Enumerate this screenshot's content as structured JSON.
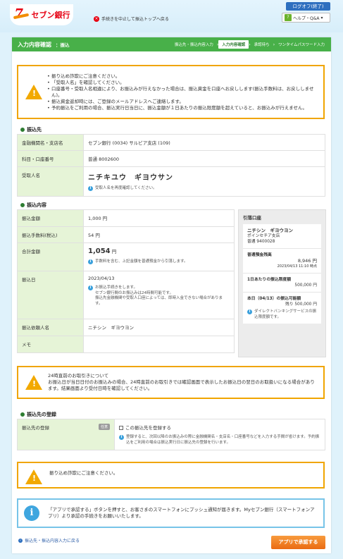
{
  "header": {
    "brand": "セブン銀行",
    "quit_link": "手続きを中止して振込トップへ戻る",
    "logout": "ログオフ(終了)",
    "help": "ヘルプ・Q&A"
  },
  "page": {
    "title": "入力内容確認",
    "subtitle": "：振込",
    "steps": [
      "振込先・振込内容入力",
      "入力内容確認",
      "承認待ち",
      "ワンタイムパスワード入力"
    ],
    "current_step": 1
  },
  "warning_top": {
    "items": [
      "振り込め詐欺にご注意ください。",
      "「受取人名」を確認してください。",
      "口座番号・受取人名相違により、お振込みが行えなかった場合は、振込資金を口座へお戻しします(振込手数料は、お戻ししません)。",
      "振込資金返却時には、ご登録のメールアドレスへご連絡します。",
      "予約振込をご利用の場合、振込実行日当日に、振込金額が１日あたりの振込限度額を超えていると、お振込みが行えません。"
    ]
  },
  "recipient": {
    "section_title": "振込先",
    "bank_label": "金融機関名・支店名",
    "bank_value": "セブン銀行 (0034) サルビア支店 (109)",
    "account_label": "科目・口座番号",
    "account_value": "普通 8002600",
    "name_label": "受取人名",
    "name_value": "ニチキユウ　ギヨウサン",
    "name_hint": "受取人名を再度確認してください。"
  },
  "transfer": {
    "section_title": "振込内容",
    "amount_label": "振込金額",
    "amount_value": "1,000 円",
    "fee_label": "振込手数料(税込)",
    "fee_value": "54 円",
    "total_label": "合計金額",
    "total_value": "1,054",
    "total_unit": "円",
    "total_hint": "手数料を含む、上記金額を普通預金から引落します。",
    "date_label": "振込日",
    "date_value": "2023/04/13",
    "date_hint_1": "お振込手続きをします。",
    "date_hint_2": "セブン銀行間のお振込みは24時間可能です。",
    "date_hint_3": "振込先金融機関や受取人口座によっては、即時入金できない場合があります。",
    "requester_label": "振込依頼人名",
    "requester_value": "ニチシン　ギヨウヨン",
    "memo_label": "メモ",
    "memo_value": ""
  },
  "source_account": {
    "title": "引落口座",
    "holder": "ニチシン　ギヨウヨン",
    "branch": "ポインセチア支店",
    "account": "普通 9400028",
    "balance_label": "普通預金残高",
    "balance_value": "8,946 円",
    "balance_time": "2023/04/13 11:10 時点",
    "daily_limit_label": "1日あたりの振込限度額",
    "daily_limit_value": "500,000 円",
    "today_label": "本日（04/13）の振込可能額",
    "today_value": "残り 500,000 円",
    "today_hint": "ダイレクトバンキングサービスの振込限度額です。"
  },
  "warning_cutoff": {
    "lines": [
      "24時直前のお取引きについて",
      "お振込日が当日日付のお振込みの場合、24時直前のお取引きでは確認画面で表示したお振込日の翌日のお取扱いになる場合があります。結果画面より受付日時を確認してください。"
    ]
  },
  "registration": {
    "section_title": "振込先の登録",
    "label": "振込先の登録",
    "badge": "任意",
    "checkbox_label": "この振込先を登録する",
    "hint": "登録すると、次回以降のお振込みの際に金融機関名・支店名・口座番号などを入力する手間が省けます。予約振込をご利用の場合は振込実行日に振込先の登録を行います。"
  },
  "warning_fraud": {
    "text": "振り込め詐欺にご注意ください。"
  },
  "info_box": {
    "text": "「アプリで承認する」ボタンを押すと、お客さまのスマートフォンにプッシュ通知が届きます。Myセブン銀行（スマートフォンアプリ）より承認の手続きをお願いいたします。"
  },
  "footer": {
    "back_link": "振込先・振込内容入力に戻る",
    "approve_button": "アプリで承認する"
  }
}
